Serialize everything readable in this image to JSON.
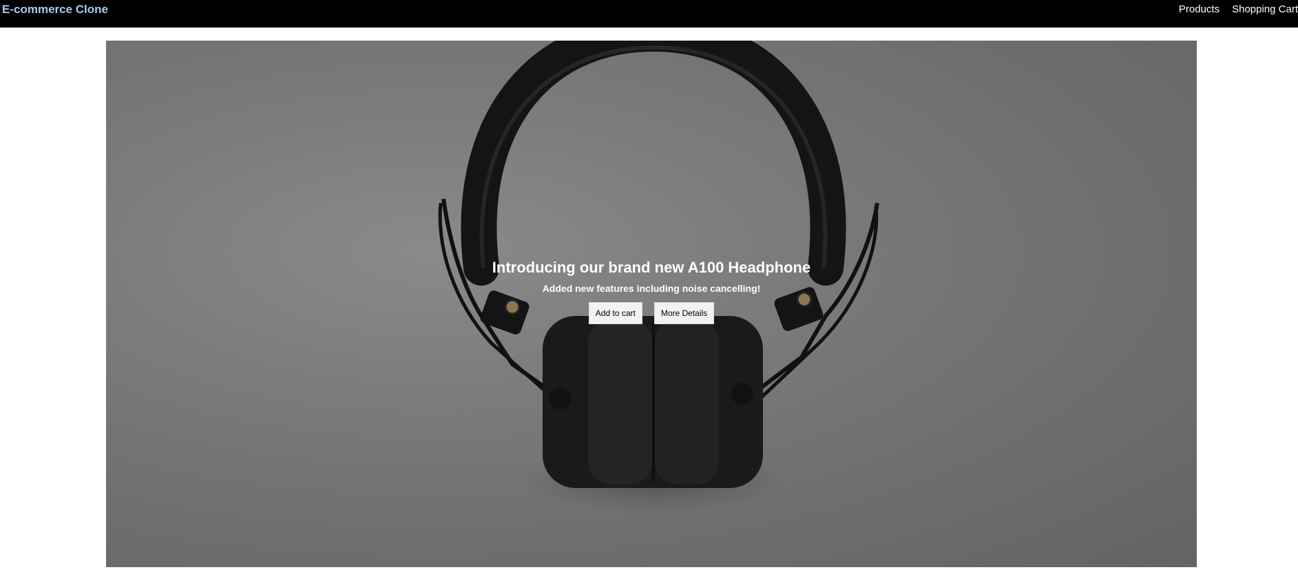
{
  "navbar": {
    "brand": "E-commerce Clone",
    "links": [
      "Products",
      "Shopping Cart"
    ]
  },
  "hero": {
    "title": "Introducing our brand new A100 Headphone",
    "subtitle": "Added new features including noise cancelling!",
    "buttons": {
      "add_to_cart": "Add to cart",
      "more_details": "More Details"
    }
  },
  "colors": {
    "navbar_background": "#000000",
    "brand_text": "#a8ccf0",
    "hero_overlay": "#6f6f6f",
    "button_background": "#f2f2f2"
  }
}
